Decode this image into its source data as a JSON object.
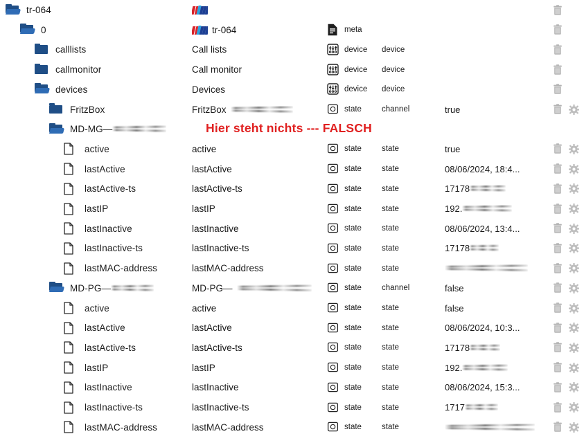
{
  "meta": {
    "accent_red": "#e02020",
    "folder_blue": "#1f4e86",
    "text_color": "#1b1b1b",
    "icon_gray": "#adadad"
  },
  "annotation": {
    "text": "Hier steht nichts --- FALSCH",
    "color": "#e02020"
  },
  "columns": {
    "tree": "tree",
    "name": "name",
    "type": "type",
    "subtype": "subtype",
    "value": "value",
    "actions": "actions"
  },
  "rows": [
    {
      "tree_label": "tr-064",
      "tree_icon": "folder-open-icon",
      "indent": 0,
      "name_label": "",
      "name_icon": "avm-logo-icon",
      "name_redacted": 0,
      "type_icon": "",
      "type": "",
      "subtype": "",
      "value": "",
      "has_trash": true,
      "has_gear": false
    },
    {
      "tree_label": "0",
      "tree_icon": "folder-open-icon",
      "indent": 1,
      "name_label": "tr-064",
      "name_icon": "avm-logo-icon",
      "name_redacted": 0,
      "type_icon": "meta-document-icon",
      "type": "meta",
      "subtype": "",
      "value": "",
      "has_trash": true,
      "has_gear": false
    },
    {
      "tree_label": "calllists",
      "tree_icon": "folder-closed-icon",
      "indent": 2,
      "name_label": "Call lists",
      "name_icon": "",
      "name_redacted": 0,
      "type_icon": "device-sliders-icon",
      "type": "device",
      "subtype": "device",
      "value": "",
      "has_trash": true,
      "has_gear": false
    },
    {
      "tree_label": "callmonitor",
      "tree_icon": "folder-closed-icon",
      "indent": 2,
      "name_label": "Call monitor",
      "name_icon": "",
      "name_redacted": 0,
      "type_icon": "device-sliders-icon",
      "type": "device",
      "subtype": "device",
      "value": "",
      "has_trash": true,
      "has_gear": false
    },
    {
      "tree_label": "devices",
      "tree_icon": "folder-open-icon",
      "indent": 2,
      "name_label": "Devices",
      "name_icon": "",
      "name_redacted": 0,
      "type_icon": "device-sliders-icon",
      "type": "device",
      "subtype": "device",
      "value": "",
      "has_trash": true,
      "has_gear": false
    },
    {
      "tree_label": "FritzBox",
      "tree_icon": "folder-closed-icon",
      "indent": 3,
      "name_label": "FritzBox",
      "name_icon": "",
      "name_redacted": 90,
      "type_icon": "state-circle-icon",
      "type": "state",
      "subtype": "channel",
      "value": "true",
      "has_trash": true,
      "has_gear": true
    },
    {
      "tree_label": "MD-MG—",
      "tree_icon": "folder-open-icon",
      "indent": 3,
      "tree_redacted": 78,
      "name_label": "",
      "name_icon": "",
      "name_redacted": 0,
      "type_icon": "",
      "type": "",
      "subtype": "",
      "value": "",
      "has_trash": false,
      "has_gear": false
    },
    {
      "tree_label": "active",
      "tree_icon": "file-icon",
      "indent": 4,
      "name_label": "active",
      "name_icon": "",
      "name_redacted": 0,
      "type_icon": "state-circle-icon",
      "type": "state",
      "subtype": "state",
      "value": "true",
      "has_trash": true,
      "has_gear": true
    },
    {
      "tree_label": "lastActive",
      "tree_icon": "file-icon",
      "indent": 4,
      "name_label": "lastActive",
      "name_icon": "",
      "name_redacted": 0,
      "type_icon": "state-circle-icon",
      "type": "state",
      "subtype": "state",
      "value": "08/06/2024, 18:4...",
      "has_trash": true,
      "has_gear": true
    },
    {
      "tree_label": "lastActive-ts",
      "tree_icon": "file-icon",
      "indent": 4,
      "name_label": "lastActive-ts",
      "name_icon": "",
      "name_redacted": 0,
      "type_icon": "state-circle-icon",
      "type": "state",
      "subtype": "state",
      "value": "17178",
      "value_redacted": 52,
      "has_trash": true,
      "has_gear": true
    },
    {
      "tree_label": "lastIP",
      "tree_icon": "file-icon",
      "indent": 4,
      "name_label": "lastIP",
      "name_icon": "",
      "name_redacted": 0,
      "type_icon": "state-circle-icon",
      "type": "state",
      "subtype": "state",
      "value": "192.",
      "value_redacted": 72,
      "has_trash": true,
      "has_gear": true
    },
    {
      "tree_label": "lastInactive",
      "tree_icon": "file-icon",
      "indent": 4,
      "name_label": "lastInactive",
      "name_icon": "",
      "name_redacted": 0,
      "type_icon": "state-circle-icon",
      "type": "state",
      "subtype": "state",
      "value": "08/06/2024, 13:4...",
      "has_trash": true,
      "has_gear": true
    },
    {
      "tree_label": "lastInactive-ts",
      "tree_icon": "file-icon",
      "indent": 4,
      "name_label": "lastInactive-ts",
      "name_icon": "",
      "name_redacted": 0,
      "type_icon": "state-circle-icon",
      "type": "state",
      "subtype": "state",
      "value": "17178",
      "value_redacted": 42,
      "has_trash": true,
      "has_gear": true
    },
    {
      "tree_label": "lastMAC-address",
      "tree_icon": "file-icon",
      "indent": 4,
      "name_label": "lastMAC-address",
      "name_icon": "",
      "name_redacted": 0,
      "type_icon": "state-circle-icon",
      "type": "state",
      "subtype": "state",
      "value": "",
      "value_redacted": 120,
      "has_trash": true,
      "has_gear": true
    },
    {
      "tree_label": "MD-PG—",
      "tree_icon": "folder-open-icon",
      "indent": 3,
      "tree_redacted": 62,
      "name_label": "MD-PG—",
      "name_icon": "",
      "name_redacted": 108,
      "type_icon": "state-circle-icon",
      "type": "state",
      "subtype": "channel",
      "value": "false",
      "has_trash": true,
      "has_gear": true
    },
    {
      "tree_label": "active",
      "tree_icon": "file-icon",
      "indent": 4,
      "name_label": "active",
      "name_icon": "",
      "name_redacted": 0,
      "type_icon": "state-circle-icon",
      "type": "state",
      "subtype": "state",
      "value": "false",
      "has_trash": true,
      "has_gear": true
    },
    {
      "tree_label": "lastActive",
      "tree_icon": "file-icon",
      "indent": 4,
      "name_label": "lastActive",
      "name_icon": "",
      "name_redacted": 0,
      "type_icon": "state-circle-icon",
      "type": "state",
      "subtype": "state",
      "value": "08/06/2024, 10:3...",
      "has_trash": true,
      "has_gear": true
    },
    {
      "tree_label": "lastActive-ts",
      "tree_icon": "file-icon",
      "indent": 4,
      "name_label": "lastActive-ts",
      "name_icon": "",
      "name_redacted": 0,
      "type_icon": "state-circle-icon",
      "type": "state",
      "subtype": "state",
      "value": "17178",
      "value_redacted": 44,
      "has_trash": true,
      "has_gear": true
    },
    {
      "tree_label": "lastIP",
      "tree_icon": "file-icon",
      "indent": 4,
      "name_label": "lastIP",
      "name_icon": "",
      "name_redacted": 0,
      "type_icon": "state-circle-icon",
      "type": "state",
      "subtype": "state",
      "value": "192.",
      "value_redacted": 66,
      "has_trash": true,
      "has_gear": true
    },
    {
      "tree_label": "lastInactive",
      "tree_icon": "file-icon",
      "indent": 4,
      "name_label": "lastInactive",
      "name_icon": "",
      "name_redacted": 0,
      "type_icon": "state-circle-icon",
      "type": "state",
      "subtype": "state",
      "value": "08/06/2024, 15:3...",
      "has_trash": true,
      "has_gear": true
    },
    {
      "tree_label": "lastInactive-ts",
      "tree_icon": "file-icon",
      "indent": 4,
      "name_label": "lastInactive-ts",
      "name_icon": "",
      "name_redacted": 0,
      "type_icon": "state-circle-icon",
      "type": "state",
      "subtype": "state",
      "value": "1717",
      "value_redacted": 48,
      "has_trash": true,
      "has_gear": true
    },
    {
      "tree_label": "lastMAC-address",
      "tree_icon": "file-icon",
      "indent": 4,
      "name_label": "lastMAC-address",
      "name_icon": "",
      "name_redacted": 0,
      "type_icon": "state-circle-icon",
      "type": "state",
      "subtype": "state",
      "value": "",
      "value_redacted": 130,
      "has_trash": true,
      "has_gear": true
    }
  ]
}
